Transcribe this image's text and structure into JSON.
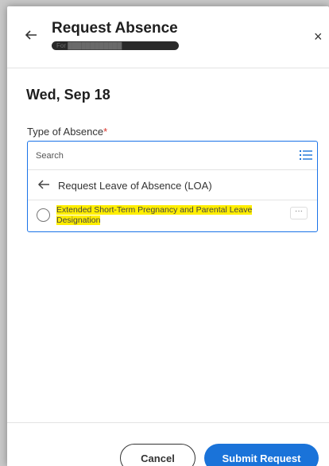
{
  "dialog": {
    "title": "Request Absence",
    "subtitle": "For ████████████",
    "back_icon": "arrow-left-icon",
    "close_icon": "close-icon",
    "close_glyph": "×"
  },
  "date": "Wed, Sep 18",
  "field": {
    "label": "Type of Absence",
    "required_marker": "*"
  },
  "prompt": {
    "search_placeholder": "Search",
    "list_icon": "list-icon",
    "nav_label": "Request Leave of Absence (LOA)",
    "options": [
      {
        "label": "Extended Short-Term Pregnancy and Parental Leave Designation",
        "highlight_color": "#ffee00",
        "more_glyph": "···"
      }
    ]
  },
  "footer": {
    "cancel_label": "Cancel",
    "submit_label": "Submit Request"
  },
  "colors": {
    "accent": "#1a73d9",
    "required": "#d9342b"
  }
}
